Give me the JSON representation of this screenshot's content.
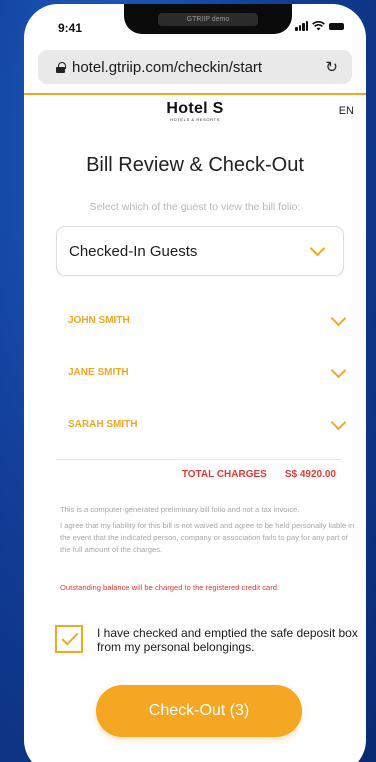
{
  "status_bar": {
    "time": "9:41",
    "notch_label": "GTRIIP demo"
  },
  "browser": {
    "url": "hotel.gtriip.com/checkin/start"
  },
  "header": {
    "brand": "Hotel S",
    "brand_sub": "HOTELS & RESORTS",
    "language": "EN"
  },
  "page": {
    "title": "Bill Review & Check-Out",
    "subtitle": "Select which of the guest to view the bill folio:"
  },
  "guest_select": {
    "value": "Checked-In Guests"
  },
  "guests": [
    {
      "name": "JOHN SMITH"
    },
    {
      "name": "JANE SMITH"
    },
    {
      "name": "SARAH SMITH"
    }
  ],
  "totals": {
    "label": "TOTAL CHARGES",
    "amount": "S$ 4920.00"
  },
  "notes": {
    "disclaimer": "This is a computer-generated preliminary bill folio and not a tax invoice.",
    "liability": "I agree that my liability for this bill is not waived and agree to be held personally liable in the event that the indicated person, company or association fails to pay for any part of the full amount of the charges.",
    "outstanding": "Outstanding balance will be charged to the registered credit card."
  },
  "confirmation": {
    "checked": true,
    "text": "I have checked and emptied the safe deposit box from my personal belongings."
  },
  "checkout_button": {
    "label": "Check-Out (3)"
  },
  "colors": {
    "accent": "#f5a623",
    "alert": "#e53935",
    "background": "#123f9a"
  }
}
